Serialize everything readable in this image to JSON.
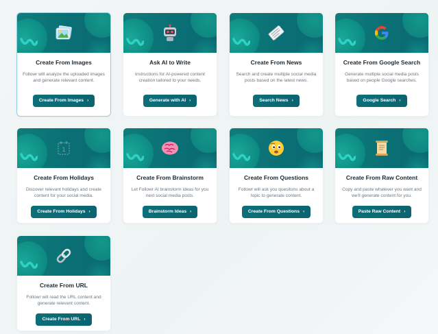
{
  "cards": [
    {
      "title": "Create From Images",
      "desc": "Followr will analyze the uploaded images and generate relevant content.",
      "button": "Create From Images",
      "icon": "image-icon",
      "selected": true
    },
    {
      "title": "Ask AI to Write",
      "desc": "Instructions for AI-powered content creation tailored to your needs.",
      "button": "Generate with AI",
      "icon": "robot-icon"
    },
    {
      "title": "Create From News",
      "desc": "Search and create multiple social media posts based on the latest news.",
      "button": "Search News",
      "icon": "newspaper-icon"
    },
    {
      "title": "Create From Google Search",
      "desc": "Generate multiple social media posts based on people Google searches.",
      "button": "Google Search",
      "icon": "google-icon"
    },
    {
      "title": "Create From Holidays",
      "desc": "Discover relevant holidays and create content for your social media.",
      "button": "Create From Holidays",
      "icon": "calendar-icon"
    },
    {
      "title": "Create From Brainstorm",
      "desc": "Let Followr AI brainstorm ideas for you next social media posts.",
      "button": "Brainstorm Ideas",
      "icon": "brain-icon"
    },
    {
      "title": "Create From Questions",
      "desc": "Followr will ask you quesitons about a topic to generate content.",
      "button": "Create From Questions",
      "icon": "thinking-face-icon"
    },
    {
      "title": "Create From Raw Content",
      "desc": "Copy and paste whatever you want and we'll generate content for you.",
      "button": "Paste Raw Content",
      "icon": "scroll-icon"
    },
    {
      "title": "Create From URL",
      "desc": "Followr will read the URL content and generate relevant content.",
      "button": "Create From URL",
      "icon": "link-icon"
    }
  ],
  "chevron": "›"
}
